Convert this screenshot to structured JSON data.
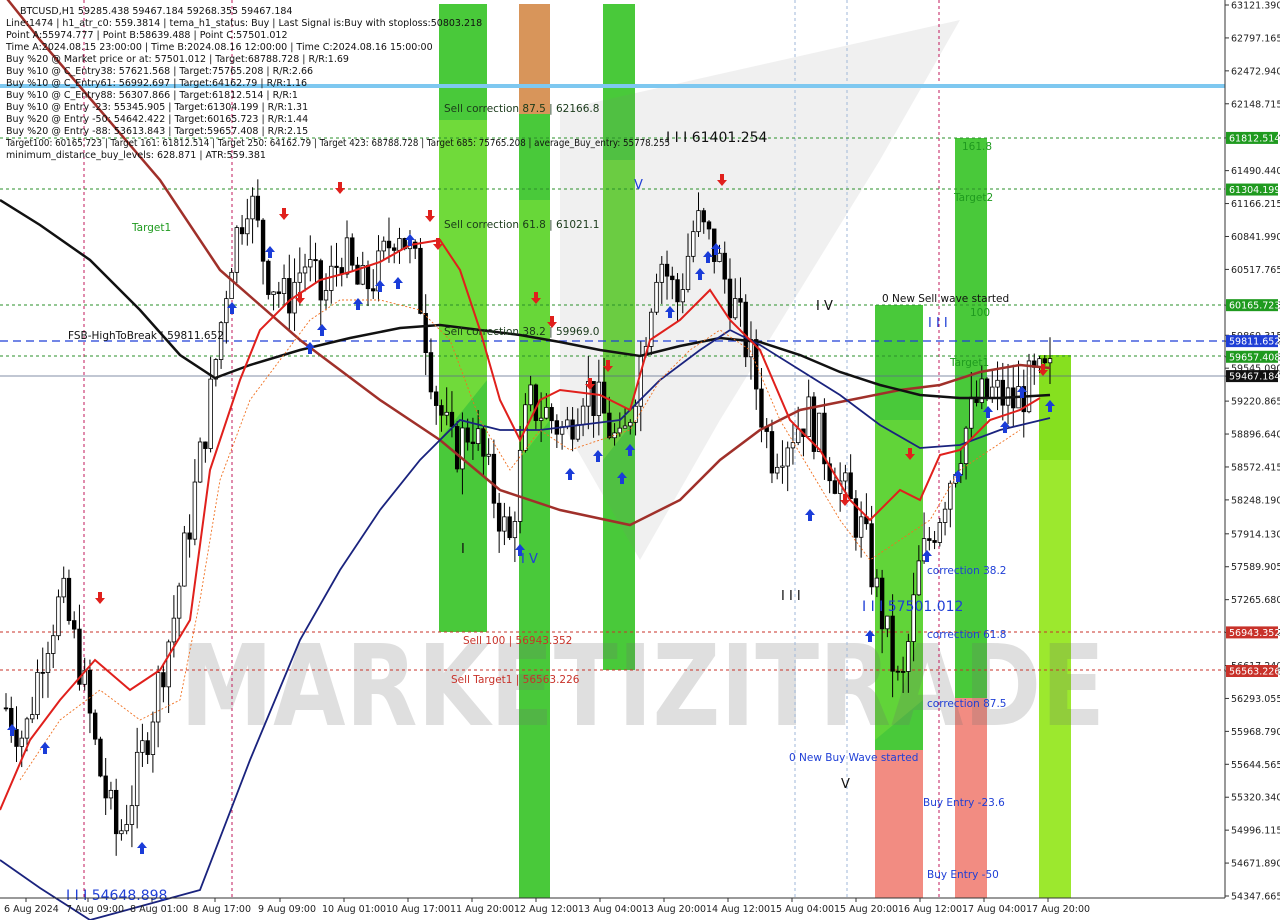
{
  "info_lines": [
    "BTCUSD,H1  59285.438 59467.184 59268.355 59467.184",
    "Line:1474  |  h1_atr_c0: 559.3814  |  tema_h1_status: Buy  |  Last Signal is:Buy with stoploss:50803.218",
    "Point A:55974.777  |  Point B:58639.488  |  Point C:57501.012",
    "Time A:2024.08.15 23:00:00  |  Time B:2024.08.16 12:00:00  |  Time C:2024.08.16 15:00:00",
    "Buy %20 @ Market price or at: 57501.012  |  Target:68788.728  |  R/R:1.69",
    "Buy %10 @ C_Entry38: 57621.568  |  Target:75765.208  |  R/R:2.66",
    "Buy %10 @ C_Entry61: 56992.697  |  Target:64162.79  |  R/R:1.16",
    "Buy %10 @ C_Entry88: 56307.866  |  Target:61812.514  |  R/R:1",
    "Buy %10 @ Entry -23: 55345.905  |  Target:61304.199  |  R/R:1.31",
    "Buy %20 @ Entry -50: 54642.422  |  Target:60165.723  |  R/R:1.44",
    "Buy %20 @ Entry -88: 53613.843  |  Target:59657.408  |  R/R:2.15",
    "Target100: 60165.723  |  Target 161: 61812.514  |  Target 250: 64162.79  |  Target 423: 68788.728  |  Target 685: 75765.208  |  average_Buy_entry: 55778.255",
    "minimum_distance_buy_levels: 628.871  |  ATR:559.381"
  ],
  "chart_data": {
    "type": "candlestick",
    "symbol": "BTCUSD",
    "timeframe": "H1",
    "ylim": [
      54347.665,
      63121.39
    ],
    "y_ticks": [
      "63121.390",
      "62797.165",
      "62472.940",
      "62148.715",
      "61812.514",
      "61490.440",
      "61166.215",
      "60841.990",
      "60517.765",
      "60165.723",
      "59869.315",
      "59811.652",
      "59657.408",
      "59545.090",
      "59467.184",
      "59220.865",
      "58896.640",
      "58572.415",
      "58248.190",
      "57914.130",
      "57589.905",
      "57265.680",
      "56943.352",
      "56617.240",
      "56563.226",
      "56293.055",
      "55968.790",
      "55644.565",
      "55320.340",
      "54996.115",
      "54671.890",
      "54347.665"
    ],
    "x_ticks": [
      "6 Aug 2024",
      "7 Aug 09:00",
      "8 Aug 01:00",
      "8 Aug 17:00",
      "9 Aug 09:00",
      "10 Aug 01:00",
      "10 Aug 17:00",
      "11 Aug 20:00",
      "12 Aug 12:00",
      "13 Aug 04:00",
      "13 Aug 20:00",
      "14 Aug 12:00",
      "15 Aug 04:00",
      "15 Aug 20:00",
      "16 Aug 12:00",
      "17 Aug 04:00",
      "17 Aug 20:00"
    ],
    "price_tags": [
      {
        "label": "61812.514",
        "value": 61812.514,
        "color": "#1f9a1f"
      },
      {
        "label": "61304.199",
        "value": 61304.199,
        "color": "#1f9a1f"
      },
      {
        "label": "60165.723",
        "value": 60165.723,
        "color": "#1f9a1f"
      },
      {
        "label": "59811.652",
        "value": 59811.652,
        "color": "#1f3fd6"
      },
      {
        "label": "59657.408",
        "value": 59657.408,
        "color": "#1f9a1f"
      },
      {
        "label": "59467.184",
        "value": 59467.184,
        "color": "#111111"
      },
      {
        "label": "56943.352",
        "value": 56943.352,
        "color": "#c8322a"
      },
      {
        "label": "56563.226",
        "value": 56563.226,
        "color": "#c8322a"
      }
    ],
    "annotations": [
      {
        "text": "Sell correction 87.5 | 62166.8",
        "color": "#1a3a1a"
      },
      {
        "text": "Sell correction 61.8 | 61021.1",
        "color": "#1a3a1a"
      },
      {
        "text": "Sell correction 38.2 | 59969.0",
        "color": "#1a3a1a"
      },
      {
        "text": "Sell 100 | 56943.352",
        "color": "#c8322a"
      },
      {
        "text": "Sell Target1 | 56563.226",
        "color": "#c8322a"
      },
      {
        "text": "I I I 61401.254",
        "color": "#111111"
      },
      {
        "text": "I I I 57501.012",
        "color": "#1f3fd6"
      },
      {
        "text": "I I I 54648.898",
        "color": "#1f3fd6"
      },
      {
        "text": "FSB-HighToBreak | 59811.652",
        "color": "#111111"
      },
      {
        "text": "Target1",
        "color": "#1f9a1f"
      },
      {
        "text": "Target2",
        "color": "#1f9a1f"
      },
      {
        "text": "161.8",
        "color": "#1f9a1f"
      },
      {
        "text": "100",
        "color": "#1f9a1f"
      },
      {
        "text": "0 New Sell wave started",
        "color": "#111111"
      },
      {
        "text": "0 New Buy Wave started",
        "color": "#1f3fd6"
      },
      {
        "text": "correction 38.2",
        "color": "#1f3fd6"
      },
      {
        "text": "correction 61.8",
        "color": "#1f3fd6"
      },
      {
        "text": "correction 87.5",
        "color": "#1f3fd6"
      },
      {
        "text": "Buy Entry -23.6",
        "color": "#1f3fd6"
      },
      {
        "text": "Buy Entry -50",
        "color": "#1f3fd6"
      },
      {
        "text": "I V",
        "color": "#111111"
      },
      {
        "text": "I V",
        "color": "#1f3fd6"
      },
      {
        "text": "I I I",
        "color": "#1f3fd6"
      },
      {
        "text": "I I I",
        "color": "#111111"
      },
      {
        "text": "V",
        "color": "#111111"
      },
      {
        "text": "V",
        "color": "#1f3fd6"
      },
      {
        "text": "I",
        "color": "#111111"
      },
      {
        "text": "Target1",
        "color": "#1f9a1f"
      }
    ],
    "watermark": "MARKETIZITRADE",
    "series": [
      {
        "type": "ohlc",
        "close_sample": [
          56200,
          55900,
          56800,
          57300,
          56600,
          55600,
          54900,
          55500,
          56300,
          57100,
          58200,
          59300,
          60600,
          61300,
          60500,
          60200,
          60600,
          60200,
          60700,
          60300,
          60500,
          61000,
          60500,
          59300,
          58700,
          59000,
          58400,
          57800,
          59200,
          59100,
          58900,
          59400,
          59100,
          58700,
          59600,
          60700,
          60200,
          61000,
          60700,
          60200,
          59600,
          58700,
          58900,
          59100,
          58700,
          58300,
          57900,
          57100,
          56300,
          57600,
          58100,
          58700,
          59200,
          59300,
          59200,
          59400,
          59467.184
        ]
      }
    ]
  }
}
